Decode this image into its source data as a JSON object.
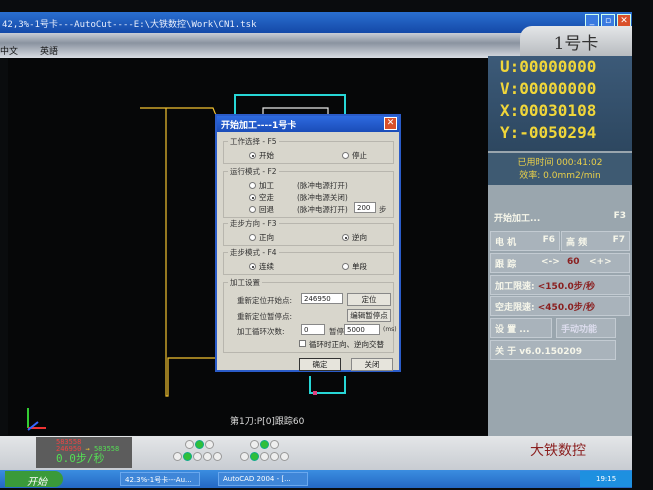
{
  "window": {
    "title": "42,3%-1号卡---AutoCut----E:\\大铁数控\\Work\\CN1.tsk",
    "minimize": "_",
    "restore": "▫",
    "close": "✕"
  },
  "menu": {
    "items": [
      "中文",
      "英語"
    ]
  },
  "card_tab": "1号卡",
  "canvas": {
    "status": "第1刀:P[0]跟踪60",
    "line_colors": {
      "path": "#f2c230",
      "cyan": "#27d6d6"
    }
  },
  "coords": {
    "u": "U:00000000",
    "v": "V:00000000",
    "x": "X:00030108",
    "y": "Y:-0050294"
  },
  "time": {
    "elapsed_label": "已用时间",
    "elapsed": "000:41:02",
    "efficiency_label": "效率:",
    "efficiency": "0.0mm2/min"
  },
  "panel": {
    "start": {
      "label": "开始加工...",
      "key": "F3"
    },
    "motor": {
      "label": "电 机",
      "key": "F6"
    },
    "hf": {
      "label": "高 频",
      "key": "F7"
    },
    "track": {
      "label": "跟 踪",
      "minus": "<->",
      "value": "60",
      "plus": "<+>"
    },
    "proc_limit": {
      "label": "加工限速:",
      "value": "<150.0步/秒"
    },
    "idle_limit": {
      "label": "空走限速:",
      "value": "<450.0步/秒"
    },
    "settings": "设 置 ...",
    "manual": "手动功能",
    "about": "关 于 v6.0.150209"
  },
  "counter": {
    "line1": "583558",
    "line2": "246950",
    "arrow": "→",
    "line3": "583558",
    "speed": "0.0步/秒"
  },
  "leds": {
    "top1": [
      false,
      true,
      false
    ],
    "top2": [
      false,
      true,
      false
    ],
    "bot1": [
      false,
      true,
      false,
      false,
      false
    ],
    "bot2": [
      false,
      true,
      false,
      false,
      false
    ]
  },
  "brand": "大铁数控",
  "taskbar": {
    "start": "开始",
    "tasks": [
      "42.3%-1号卡---Au...",
      "AutoCAD 2004 - [..."
    ],
    "clock": "19:15"
  },
  "dialog": {
    "title": "开始加工----1号卡",
    "close": "✕",
    "work": {
      "legend": "工作选择 - F5",
      "options": [
        "开始",
        "停止"
      ],
      "selected": 0
    },
    "mode": {
      "legend": "运行模式 - F2",
      "options": [
        "加工",
        "空走",
        "回退"
      ],
      "notes": [
        "(脉冲电源打开)",
        "(脉冲电源关闭)",
        "(脉冲电源打开)"
      ],
      "selected": 1,
      "steps": "200",
      "steps_unit": "步"
    },
    "direction": {
      "legend": "走步方向 - F3",
      "options": [
        "正向",
        "逆向"
      ],
      "selected": 1
    },
    "stepmode": {
      "legend": "走步模式 - F4",
      "options": [
        "连续",
        "单段"
      ],
      "selected": 0
    },
    "settings": {
      "legend": "加工设置",
      "reposition_start_label": "重新定位开始点:",
      "reposition_start": "246950",
      "locate_btn": "定位",
      "reposition_pause_label": "重新定位暂停点:",
      "edit_pause_btn": "编辑暂停点",
      "cycles_label": "加工循环次数:",
      "cycles": "0",
      "pause_label": "暂停",
      "pause": "5000",
      "pause_unit": "(ms)",
      "alternate_label": "循环时正向、逆向交替",
      "alternate": false
    },
    "ok": "确定",
    "close_btn": "关闭"
  }
}
